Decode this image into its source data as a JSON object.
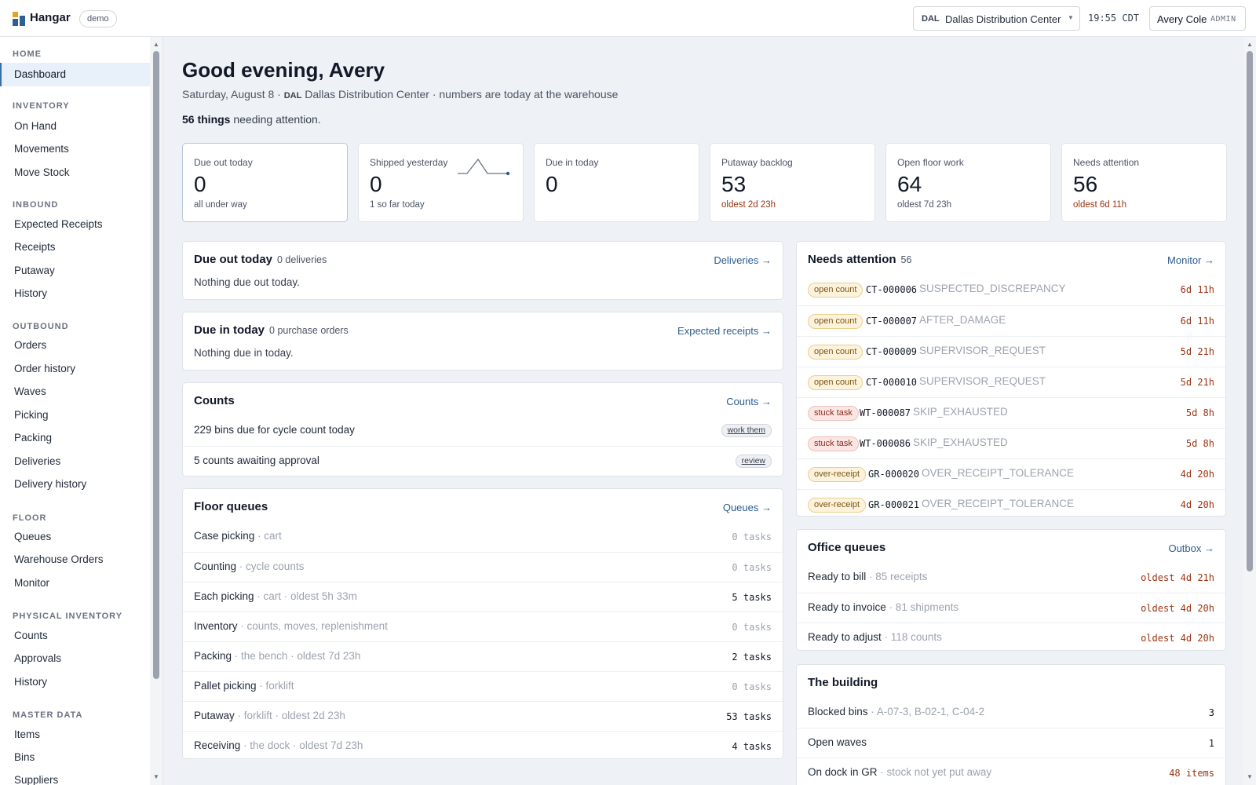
{
  "app": {
    "name": "Hangar",
    "env_badge": "demo"
  },
  "topbar": {
    "site_code": "DAL",
    "site_name": "Dallas Distribution Center",
    "clock": "19:55 CDT",
    "user_name": "Avery Cole",
    "user_role": "ADMIN"
  },
  "sidebar": {
    "home_heading": "HOME",
    "dashboard": "Dashboard",
    "inventory_heading": "INVENTORY",
    "on_hand": "On Hand",
    "movements": "Movements",
    "move_stock": "Move Stock",
    "inbound_heading": "INBOUND",
    "expected_receipts": "Expected Receipts",
    "receipts": "Receipts",
    "putaway": "Putaway",
    "inbound_history": "History",
    "outbound_heading": "OUTBOUND",
    "orders": "Orders",
    "order_history": "Order history",
    "waves": "Waves",
    "picking": "Picking",
    "packing": "Packing",
    "deliveries": "Deliveries",
    "delivery_history": "Delivery history",
    "floor_heading": "FLOOR",
    "queues": "Queues",
    "warehouse_orders": "Warehouse Orders",
    "monitor": "Monitor",
    "physical_heading": "PHYSICAL INVENTORY",
    "counts": "Counts",
    "approvals": "Approvals",
    "physical_history": "History",
    "master_heading": "MASTER DATA",
    "items": "Items",
    "bins": "Bins",
    "suppliers": "Suppliers"
  },
  "header": {
    "greeting": "Good evening, Avery",
    "date": "Saturday, August 8 · ",
    "site_code": "DAL",
    "site_note": " Dallas Distribution Center · numbers are today at the warehouse",
    "attention_count": "56 things",
    "attention_suffix": " needing attention."
  },
  "kpis": {
    "due_out": {
      "label": "Due out today",
      "value": "0",
      "sub": "all under way"
    },
    "shipped": {
      "label": "Shipped yesterday",
      "value": "0",
      "sub": "1 so far today"
    },
    "due_in": {
      "label": "Due in today",
      "value": "0"
    },
    "putaway": {
      "label": "Putaway backlog",
      "value": "53",
      "sub": "oldest 2d 23h"
    },
    "floor": {
      "label": "Open floor work",
      "value": "64",
      "sub": "oldest 7d 23h"
    },
    "attention": {
      "label": "Needs attention",
      "value": "56",
      "sub": "oldest 6d 11h"
    }
  },
  "due_out_card": {
    "title": "Due out today",
    "meta": "0 deliveries",
    "link": "Deliveries →",
    "empty": "Nothing due out today."
  },
  "due_in_card": {
    "title": "Due in today",
    "meta": "0 purchase orders",
    "link": "Expected receipts →",
    "empty": "Nothing due in today."
  },
  "counts_card": {
    "title": "Counts",
    "link": "Counts →",
    "row1": "229 bins due for cycle count today",
    "row1_btn": "work them",
    "row2": "5 counts awaiting approval",
    "row2_btn": "review"
  },
  "floor_queues": {
    "title": "Floor queues",
    "link": "Queues →",
    "rows": [
      {
        "name": "Case picking",
        "detail": " · cart",
        "count": "0 tasks"
      },
      {
        "name": "Counting",
        "detail": " · cycle counts",
        "count": "0 tasks"
      },
      {
        "name": "Each picking",
        "detail": " · cart · oldest 5h 33m",
        "count": "5 tasks"
      },
      {
        "name": "Inventory",
        "detail": " · counts, moves, replenishment",
        "count": "0 tasks"
      },
      {
        "name": "Packing",
        "detail": " · the bench · oldest 7d 23h",
        "count": "2 tasks"
      },
      {
        "name": "Pallet picking",
        "detail": " · forklift",
        "count": "0 tasks"
      },
      {
        "name": "Putaway",
        "detail": " · forklift · oldest 2d 23h",
        "count": "53 tasks"
      },
      {
        "name": "Receiving",
        "detail": " · the dock · oldest 7d 23h",
        "count": "4 tasks"
      }
    ]
  },
  "needs_attention": {
    "title": "Needs attention",
    "count": "56",
    "link": "Monitor →",
    "rows": [
      {
        "tag": "open count",
        "ref": "CT-000006",
        "reason": "SUSPECTED_DISCREPANCY",
        "age": "6d 11h"
      },
      {
        "tag": "open count",
        "ref": "CT-000007",
        "reason": "AFTER_DAMAGE",
        "age": "6d 11h"
      },
      {
        "tag": "open count",
        "ref": "CT-000009",
        "reason": "SUPERVISOR_REQUEST",
        "age": "5d 21h"
      },
      {
        "tag": "open count",
        "ref": "CT-000010",
        "reason": "SUPERVISOR_REQUEST",
        "age": "5d 21h"
      },
      {
        "tag": "stuck task",
        "ref": "WT-000087",
        "reason": "SKIP_EXHAUSTED",
        "age": "5d 8h"
      },
      {
        "tag": "stuck task",
        "ref": "WT-000086",
        "reason": "SKIP_EXHAUSTED",
        "age": "5d 8h"
      },
      {
        "tag": "over-receipt",
        "ref": "GR-000020",
        "reason": "OVER_RECEIPT_TOLERANCE",
        "age": "4d 20h"
      },
      {
        "tag": "over-receipt",
        "ref": "GR-000021",
        "reason": "OVER_RECEIPT_TOLERANCE",
        "age": "4d 20h"
      }
    ]
  },
  "office_queues": {
    "title": "Office queues",
    "link": "Outbox →",
    "rows": [
      {
        "name": "Ready to bill",
        "detail": " · 85 receipts",
        "age": "oldest 4d 21h"
      },
      {
        "name": "Ready to invoice",
        "detail": " · 81 shipments",
        "age": "oldest 4d 20h"
      },
      {
        "name": "Ready to adjust",
        "detail": " · 118 counts",
        "age": "oldest 4d 20h"
      }
    ]
  },
  "building": {
    "title": "The building",
    "rows": [
      {
        "name": "Blocked bins",
        "detail": " · A-07-3, B-02-1, C-04-2",
        "value": "3"
      },
      {
        "name": "Open waves",
        "detail": "",
        "value": "1"
      },
      {
        "name": "On dock in GR",
        "detail": " · stock not yet put away",
        "value": "48 items"
      }
    ]
  },
  "colors": {
    "accent": "#2c5d92",
    "warn": "#9a3412",
    "open_tag": "#fdf3dc",
    "stuck_tag": "#fbe6e3"
  }
}
